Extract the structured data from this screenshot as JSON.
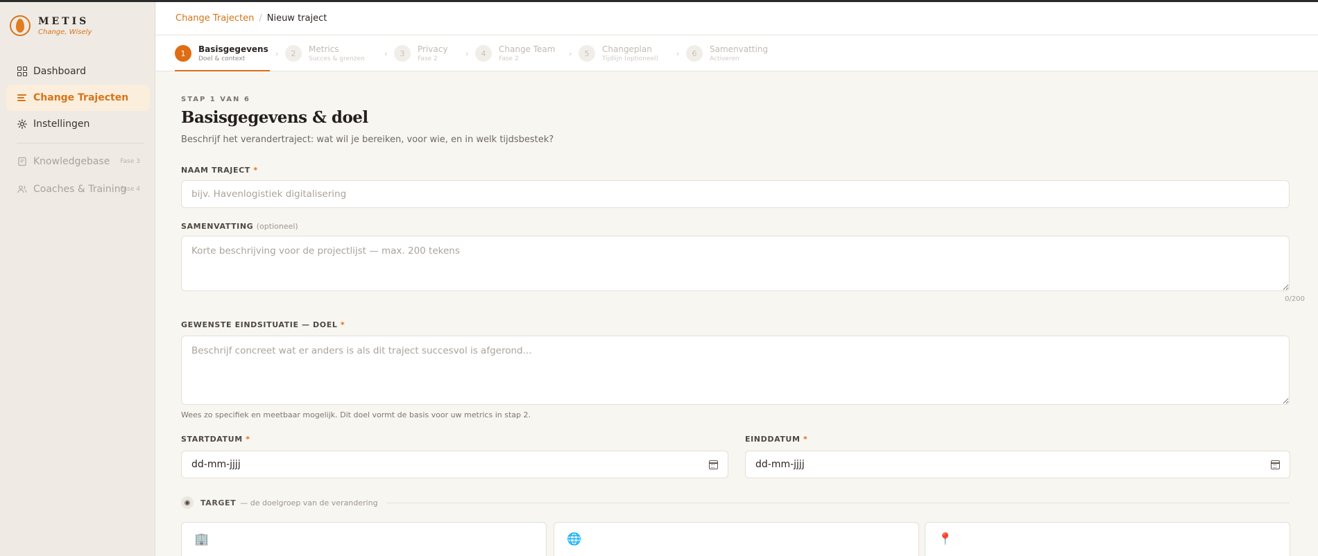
{
  "brand": {
    "name": "METIS",
    "tagline": "Change, Wisely"
  },
  "sidebar": {
    "items": [
      {
        "label": "Dashboard",
        "icon": "dashboard-grid-icon"
      },
      {
        "label": "Change Trajecten",
        "icon": "list-icon",
        "active": true
      },
      {
        "label": "Instellingen",
        "icon": "gear-icon"
      },
      {
        "label": "Knowledgebase",
        "icon": "book-icon",
        "badge": "Fase 3",
        "disabled": true
      },
      {
        "label": "Coaches & Training",
        "icon": "users-icon",
        "badge": "Fase 4",
        "disabled": true
      }
    ]
  },
  "breadcrumb": {
    "parent": "Change Trajecten",
    "separator": "/",
    "current": "Nieuw traject"
  },
  "stepper": {
    "steps": [
      {
        "num": "1",
        "title": "Basisgegevens",
        "sub": "Doel & context",
        "active": true
      },
      {
        "num": "2",
        "title": "Metrics",
        "sub": "Succes & grenzen"
      },
      {
        "num": "3",
        "title": "Privacy",
        "sub": "Fase 2"
      },
      {
        "num": "4",
        "title": "Change Team",
        "sub": "Fase 2"
      },
      {
        "num": "5",
        "title": "Changeplan",
        "sub": "Tijdlijn (optioneel)"
      },
      {
        "num": "6",
        "title": "Samenvatting",
        "sub": "Activeren"
      }
    ]
  },
  "form": {
    "eyebrow": "STAP 1 VAN 6",
    "title": "Basisgegevens & doel",
    "subtitle": "Beschrijf het verandertraject: wat wil je bereiken, voor wie, en in welk tijdsbestek?",
    "naam": {
      "label": "NAAM TRAJECT",
      "required": "*",
      "placeholder": "bijv. Havenlogistiek digitalisering",
      "value": ""
    },
    "samenvatting": {
      "label": "SAMENVATTING",
      "optional": "(optioneel)",
      "placeholder": "Korte beschrijving voor de projectlijst — max. 200 tekens",
      "counter": "0/200",
      "value": ""
    },
    "doel": {
      "label": "GEWENSTE EINDSITUATIE — DOEL",
      "required": "*",
      "placeholder": "Beschrijf concreet wat er anders is als dit traject succesvol is afgerond...",
      "hint": "Wees zo specifiek en meetbaar mogelijk. Dit doel vormt de basis voor uw metrics in stap 2.",
      "value": ""
    },
    "startdatum": {
      "label": "STARTDATUM",
      "required": "*",
      "value": "dd-mm-jjjj"
    },
    "einddatum": {
      "label": "EINDDATUM",
      "required": "*",
      "value": "dd-mm-jjjj"
    },
    "target": {
      "label": "TARGET",
      "desc": "— de doelgroep van de verandering"
    },
    "target_cards": [
      {
        "icon": "building-icon",
        "glyph": "🏢"
      },
      {
        "icon": "globe-icon",
        "glyph": "🌐"
      },
      {
        "icon": "pin-icon",
        "glyph": "📍"
      }
    ]
  },
  "colors": {
    "accent": "#e06d14",
    "background": "#f8f6f1",
    "sidebar": "#efebe4"
  }
}
